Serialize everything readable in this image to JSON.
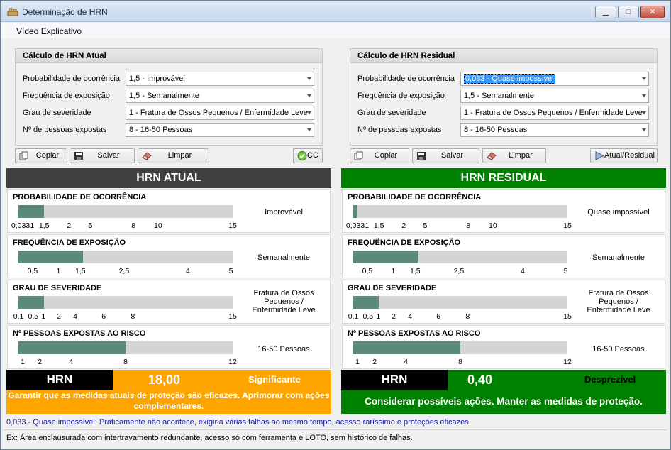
{
  "window": {
    "title": "Determinação de HRN"
  },
  "menu": {
    "items": [
      "Vídeo Explicativo"
    ]
  },
  "atual_group": {
    "title": "Cálculo de HRN Atual",
    "fields": [
      {
        "label": "Probabilidade de ocorrência",
        "value": "1,5 - Improvável"
      },
      {
        "label": "Frequência de exposição",
        "value": "1,5 - Semanalmente"
      },
      {
        "label": "Grau de severidade",
        "value": "1 - Fratura de Ossos Pequenos / Enfermidade Leve"
      },
      {
        "label": "Nº de pessoas expostas",
        "value": "8 - 16-50 Pessoas"
      }
    ]
  },
  "residual_group": {
    "title": "Cálculo de HRN Residual",
    "fields": [
      {
        "label": "Probabilidade de ocorrência",
        "value": "0,033 - Quase impossível"
      },
      {
        "label": "Frequência de exposição",
        "value": "1,5 - Semanalmente"
      },
      {
        "label": "Grau de severidade",
        "value": "1 - Fratura de Ossos Pequenos / Enfermidade Leve"
      },
      {
        "label": "Nº de pessoas expostas",
        "value": "8 - 16-50 Pessoas"
      }
    ]
  },
  "buttons": {
    "copy": "Copiar",
    "save": "Salvar",
    "clear": "Limpar",
    "cc": "CC",
    "toggle": "Atual/Residual"
  },
  "atual": {
    "header": "HRN ATUAL",
    "header_color": "#404040",
    "panels": [
      {
        "title": "PROBABILIDADE DE OCORRÊNCIA",
        "level": 1.5,
        "max": 15,
        "value_text": "Improvável",
        "ticks": [
          "0,033",
          "1",
          "1,5",
          "2",
          "5",
          "8",
          "10",
          "15"
        ]
      },
      {
        "title": "FREQUÊNCIA DE EXPOSIÇÃO",
        "level": 1.5,
        "max": 5,
        "value_text": "Semanalmente",
        "ticks": [
          "0,5",
          "1",
          "1,5",
          "2,5",
          "4",
          "5"
        ]
      },
      {
        "title": "GRAU DE SEVERIDADE",
        "level": 1,
        "max": 15,
        "value_text": "Fratura de Ossos Pequenos / Enfermidade Leve",
        "ticks": [
          "0,1",
          "0,5",
          "1",
          "2",
          "4",
          "6",
          "8",
          "15"
        ]
      },
      {
        "title": "Nº PESSOAS EXPOSTAS AO RISCO",
        "level": 8,
        "max": 12,
        "value_text": "16-50 Pessoas",
        "ticks": [
          "1",
          "2",
          "4",
          "8",
          "12"
        ]
      }
    ],
    "hrn_label": "HRN",
    "hrn_value": "18,00",
    "classification": "Significante",
    "classification_color": "#ffffff",
    "result_color": "#ffa500",
    "action": "Garantir que as medidas atuais de proteção são eficazes. Aprimorar com ações complementares."
  },
  "residual": {
    "header": "HRN RESIDUAL",
    "header_color": "#008000",
    "panels": [
      {
        "title": "PROBABILIDADE DE OCORRÊNCIA",
        "level": 0.033,
        "max": 15,
        "value_text": "Quase impossível",
        "ticks": [
          "0,033",
          "1",
          "1,5",
          "2",
          "5",
          "8",
          "10",
          "15"
        ]
      },
      {
        "title": "FREQUÊNCIA DE EXPOSIÇÃO",
        "level": 1.5,
        "max": 5,
        "value_text": "Semanalmente",
        "ticks": [
          "0,5",
          "1",
          "1,5",
          "2,5",
          "4",
          "5"
        ]
      },
      {
        "title": "GRAU DE SEVERIDADE",
        "level": 1,
        "max": 15,
        "value_text": "Fratura de Ossos Pequenos / Enfermidade Leve",
        "ticks": [
          "0,1",
          "0,5",
          "1",
          "2",
          "4",
          "6",
          "8",
          "15"
        ]
      },
      {
        "title": "Nº PESSOAS EXPOSTAS AO RISCO",
        "level": 8,
        "max": 12,
        "value_text": "16-50 Pessoas",
        "ticks": [
          "1",
          "2",
          "4",
          "8",
          "12"
        ]
      }
    ],
    "hrn_label": "HRN",
    "hrn_value": "0,40",
    "classification": "Desprezível",
    "classification_color": "#000000",
    "result_color": "#008000",
    "action": "Considerar possíveis ações. Manter as medidas de proteção."
  },
  "notes": {
    "description": "0,033 - Quase impossível: Praticamente não acontece, exigiria várias falhas ao mesmo tempo, acesso raríssimo e proteções eficazes.",
    "description_color": "#1a1aa6",
    "example": "Ex: Área enclausurada com intertravamento redundante, acesso só com ferramenta e LOTO, sem histórico de falhas."
  }
}
